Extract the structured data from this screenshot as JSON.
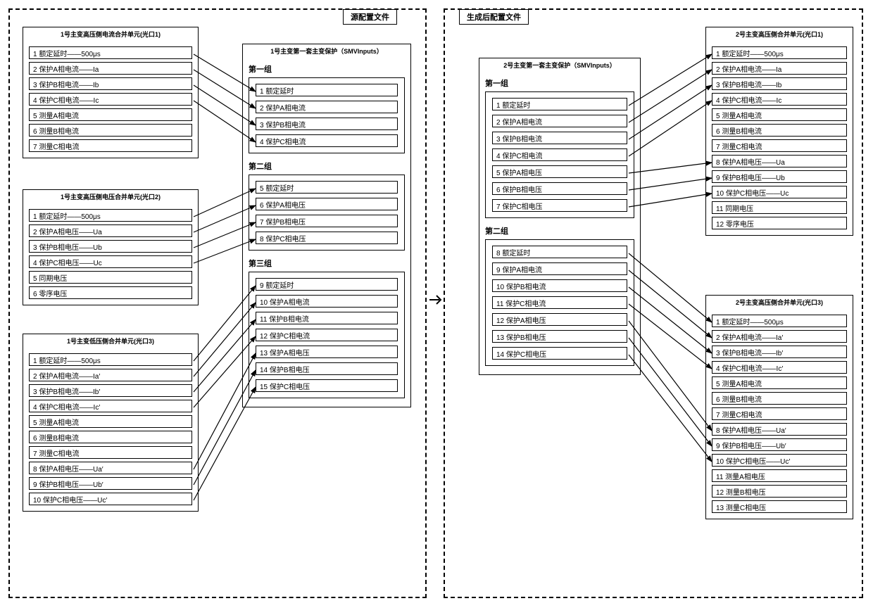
{
  "left_title": "源配置文件",
  "right_title": "生成后配置文件",
  "left": {
    "src1": {
      "title": "1号主变高压侧电流合并单元(光口1)",
      "items": [
        "1 额定延时——500μs",
        "2 保护A相电流——Ia",
        "3 保护B相电流——Ib",
        "4 保护C相电流——Ic",
        "5 测量A相电流",
        "6 测量B相电流",
        "7 测量C相电流"
      ]
    },
    "src2": {
      "title": "1号主变高压侧电压合并单元(光口2)",
      "items": [
        "1 额定延时——500μs",
        "2 保护A相电压——Ua",
        "3 保护B相电压——Ub",
        "4 保护C相电压——Uc",
        "5 同期电压",
        "6 零序电压"
      ]
    },
    "src3": {
      "title": "1号主变低压侧合并单元(光口3)",
      "items": [
        "1 额定延时——500μs",
        "2 保护A相电流——Ia′",
        "3 保护B相电流——Ib′",
        "4 保护C相电流——Ic′",
        "5 测量A相电流",
        "6 测量B相电流",
        "7 测量C相电流",
        "8 保护A相电压——Ua′",
        "9 保护B相电压——Ub′",
        "10 保护C相电压——Uc′"
      ]
    },
    "mid": {
      "title": "1号主变第一套主变保护（SMVInputs）",
      "g1_label": "第一组",
      "g1": [
        "1 额定延时",
        "2 保护A相电流",
        "3 保护B相电流",
        "4 保护C相电流"
      ],
      "g2_label": "第二组",
      "g2": [
        "5 额定延时",
        "6 保护A相电压",
        "7 保护B相电压",
        "8 保护C相电压"
      ],
      "g3_label": "第三组",
      "g3": [
        "9 额定延时",
        "10 保护A相电流",
        "11 保护B相电流",
        "12 保护C相电流",
        "13 保护A相电压",
        "14 保护B相电压",
        "15 保护C相电压"
      ]
    }
  },
  "right": {
    "mid": {
      "title": "2号主变第一套主变保护（SMVInputs）",
      "g1_label": "第一组",
      "g1": [
        "1 额定延时",
        "2 保护A相电流",
        "3 保护B相电流",
        "4 保护C相电流",
        "5 保护A相电压",
        "6 保护B相电压",
        "7 保护C相电压"
      ],
      "g2_label": "第二组",
      "g2": [
        "8 额定延时",
        "9 保护A相电流",
        "10 保护B相电流",
        "11 保护C相电流",
        "12 保护A相电压",
        "13 保护B相电压",
        "14 保护C相电压"
      ]
    },
    "dst1": {
      "title": "2号主变高压侧合并单元(光口1)",
      "items": [
        "1 额定延时——500μs",
        "2 保护A相电流——Ia",
        "3 保护B相电流——Ib",
        "4 保护C相电流——Ic",
        "5 测量A相电流",
        "6 测量B相电流",
        "7 测量C相电流",
        "8 保护A相电压——Ua",
        "9 保护B相电压——Ub",
        "10 保护C相电压——Uc",
        "11 同期电压",
        "12 零序电压"
      ]
    },
    "dst2": {
      "title": "2号主变高压侧合并单元(光口3)",
      "items": [
        "1 额定延时——500μs",
        "2 保护A相电流——Ia′",
        "3 保护B相电流——Ib′",
        "4 保护C相电流——Ic′",
        "5 测量A相电流",
        "6 测量B相电流",
        "7 测量C相电流",
        "8 保护A相电压——Ua′",
        "9 保护B相电压——Ub′",
        "10 保护C相电压——Uc′",
        "11 测量A相电压",
        "12 测量B相电压",
        "13 测量C相电压"
      ]
    }
  }
}
